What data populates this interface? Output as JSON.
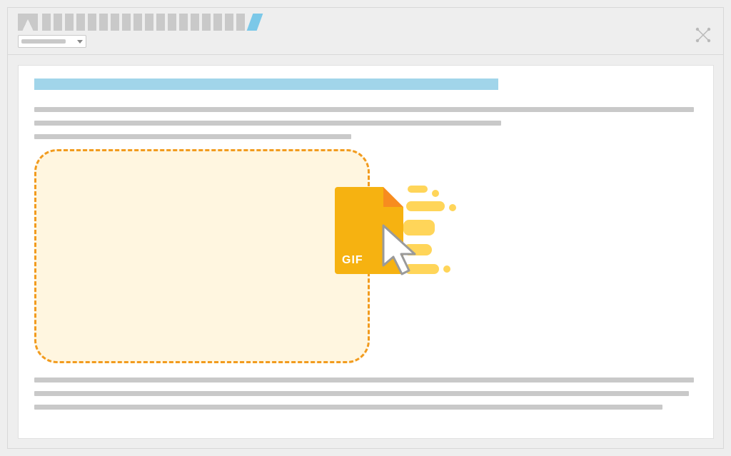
{
  "toolbar": {
    "icon_blocks_count": 22,
    "accent_index": 22,
    "dropdown_placeholder": ""
  },
  "content": {
    "title_highlight_color": "#a1d5ea",
    "line1_width": 924,
    "line2_width": 654,
    "line3_width": 444,
    "line_b1_width": 924,
    "line_b2_width": 917,
    "line_b3_width": 880
  },
  "dropzone": {
    "border_color": "#f29b1e",
    "fill_color": "#fff6e0"
  },
  "file": {
    "type_label": "GIF",
    "fill_color": "#f6b211",
    "fold_color": "#f78c1f",
    "trail_color": "#ffd559"
  },
  "icons": {
    "fullscreen": "fullscreen-icon",
    "cursor": "cursor-icon",
    "dropdown_arrow": "chevron-down-icon"
  }
}
